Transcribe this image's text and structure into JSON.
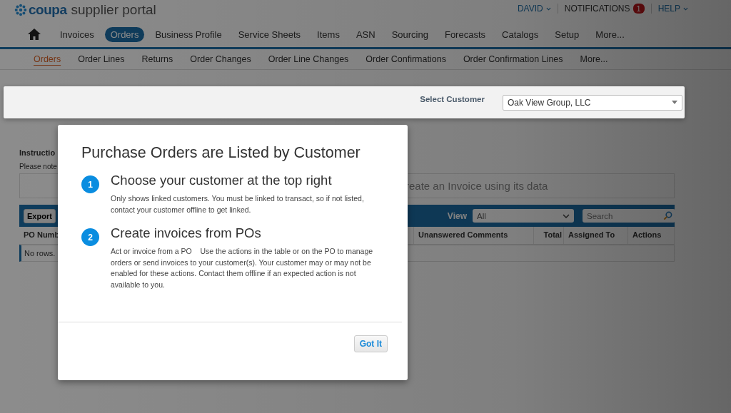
{
  "logo": {
    "brand": "coupa",
    "product": "supplier portal"
  },
  "user_menu": [
    {
      "label": "DAVID",
      "kind": "dropdown"
    },
    {
      "label": "NOTIFICATIONS",
      "kind": "badge",
      "badge": "1"
    },
    {
      "label": "HELP",
      "kind": "dropdown"
    }
  ],
  "main_nav": [
    {
      "label": "Invoices",
      "selected": false
    },
    {
      "label": "Orders",
      "selected": true
    },
    {
      "label": "Business Profile",
      "selected": false
    },
    {
      "label": "Service Sheets",
      "selected": false
    },
    {
      "label": "Items",
      "selected": false
    },
    {
      "label": "ASN",
      "selected": false
    },
    {
      "label": "Sourcing",
      "selected": false
    },
    {
      "label": "Forecasts",
      "selected": false
    },
    {
      "label": "Catalogs",
      "selected": false
    },
    {
      "label": "Setup",
      "selected": false
    },
    {
      "label": "More...",
      "selected": false
    }
  ],
  "sub_nav": [
    {
      "label": "Orders",
      "selected": true
    },
    {
      "label": "Order Lines",
      "selected": false
    },
    {
      "label": "Returns",
      "selected": false
    },
    {
      "label": "Order Changes",
      "selected": false
    },
    {
      "label": "Order Line Changes",
      "selected": false
    },
    {
      "label": "Order Confirmations",
      "selected": false
    },
    {
      "label": "Order Confirmation Lines",
      "selected": false
    },
    {
      "label": "More...",
      "selected": false
    }
  ],
  "customer_bar": {
    "label": "Select Customer",
    "value": "Oak View Group, LLC"
  },
  "page": {
    "instructions_heading": "Instructio",
    "note": "Please note",
    "banner": "reate an Invoice using its data",
    "toolbar": {
      "export": "Export",
      "view_label": "View",
      "view_value": "All",
      "search_placeholder": "Search"
    },
    "columns": [
      "PO Numb",
      "Unanswered Comments",
      "Total",
      "Assigned To",
      "Actions"
    ],
    "empty": "No rows."
  },
  "modal": {
    "title": "Purchase Orders are Listed by Customer",
    "steps": [
      {
        "number": "1",
        "heading": "Choose your customer at the top right",
        "text": "Only shows linked customers. You must be linked to transact, so if not listed, contact your customer offline to get linked."
      },
      {
        "number": "2",
        "heading": "Create invoices from POs",
        "text": "Act or invoice from a PO    Use the actions in the table or on the PO to manage orders or send invoices to your customer(s). Your customer may or may not be enabled for these actions. Contact them offline if an expected action is not available to you."
      }
    ],
    "button": "Got It"
  }
}
